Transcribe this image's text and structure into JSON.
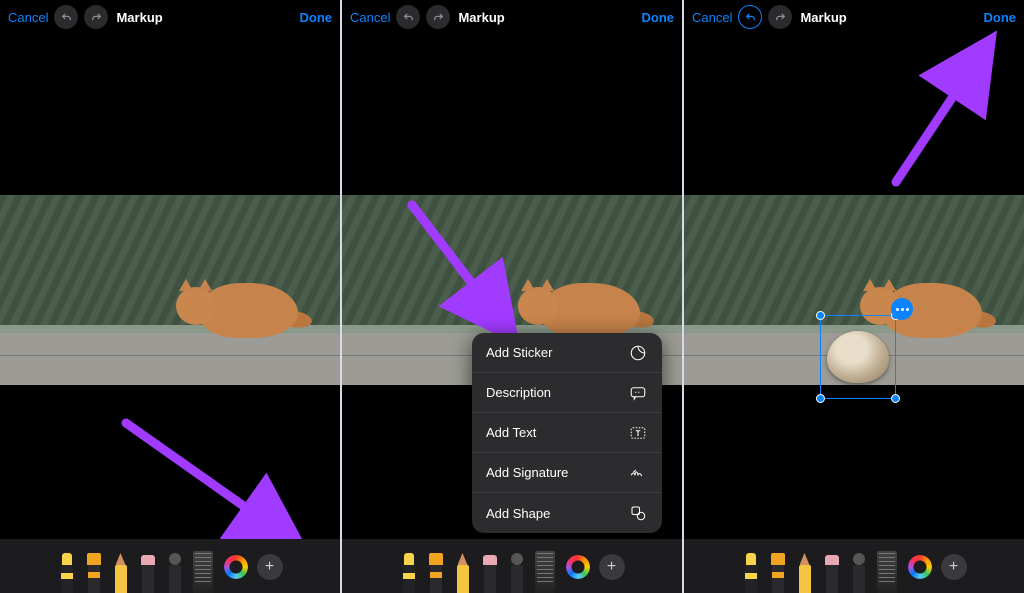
{
  "header": {
    "cancel": "Cancel",
    "title": "Markup",
    "done": "Done"
  },
  "menu": {
    "add_sticker": "Add Sticker",
    "description": "Description",
    "add_text": "Add Text",
    "add_signature": "Add Signature",
    "add_shape": "Add Shape"
  },
  "icons": {
    "undo": "↶",
    "redo": "↷",
    "plus": "+"
  },
  "tools": [
    "pen",
    "marker",
    "pencil",
    "eraser",
    "lasso",
    "ruler"
  ]
}
